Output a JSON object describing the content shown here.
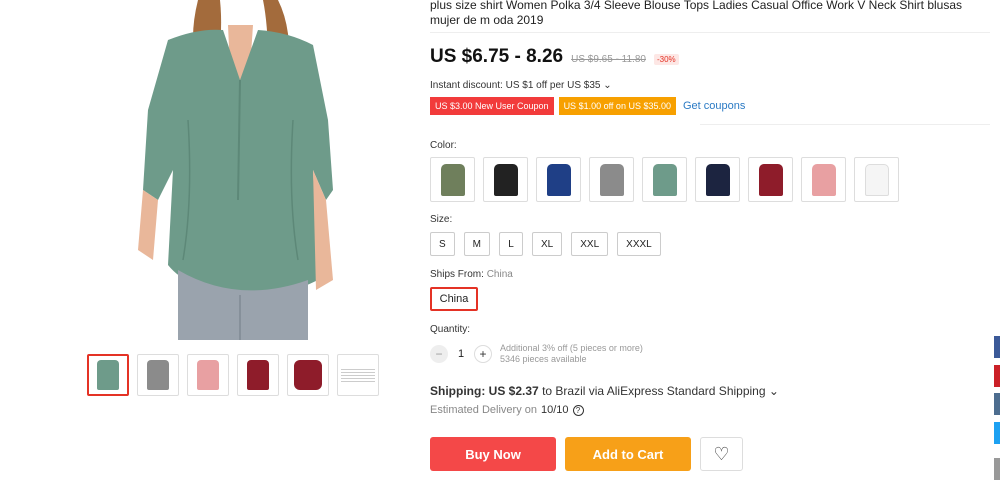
{
  "product": {
    "title": "plus size shirt Women Polka 3/4 Sleeve Blouse Tops Ladies Casual Office Work V Neck Shirt blusas mujer de m oda 2019",
    "price": "US $6.75 - 8.26",
    "original_price": "US $9.65 - 11.80",
    "discount": "-30%"
  },
  "promo": {
    "instant_discount": "Instant discount: US $1 off per US $35 ⌄",
    "coupon_new_user": "US $3.00 New User Coupon",
    "coupon_off": "US $1.00 off on US $35.00",
    "get_coupons": "Get coupons"
  },
  "options": {
    "color_label": "Color:",
    "colors": [
      "#6f7f5c",
      "#222222",
      "#1f3f86",
      "#8b8b8b",
      "#6e9b8a",
      "#1c2440",
      "#8e1c2a",
      "#e8a0a2",
      "#f5f5f5"
    ],
    "size_label": "Size:",
    "sizes": [
      "S",
      "M",
      "L",
      "XL",
      "XXL",
      "XXXL"
    ],
    "ships_label": "Ships From:",
    "ships_value": "China",
    "ships_button": "China"
  },
  "quantity": {
    "label": "Quantity:",
    "value": "1",
    "minus": "−",
    "plus": "+",
    "note": "Additional 3% off (5 pieces or more)",
    "available": "5346 pieces available"
  },
  "shipping": {
    "prefix": "Shipping:",
    "cost": "US $2.37",
    "suffix": "to Brazil via AliExpress Standard Shipping ⌄",
    "delivery_prefix": "Estimated Delivery on",
    "delivery_date": "10/10",
    "help_icon": "?"
  },
  "actions": {
    "buy_now": "Buy Now",
    "add_to_cart": "Add to Cart",
    "wishlist_icon": "♡"
  },
  "gallery": {
    "thumb_colors": [
      "#6e9b8a",
      "#8b8b8b",
      "#e8a0a2",
      "#8e1c2a",
      "#8e1c2a",
      "#ffffff"
    ]
  },
  "social": {
    "colors": [
      "#3b5998",
      "#cb2027",
      "#4d6d8f",
      "#1da1f2",
      "#999999"
    ]
  }
}
